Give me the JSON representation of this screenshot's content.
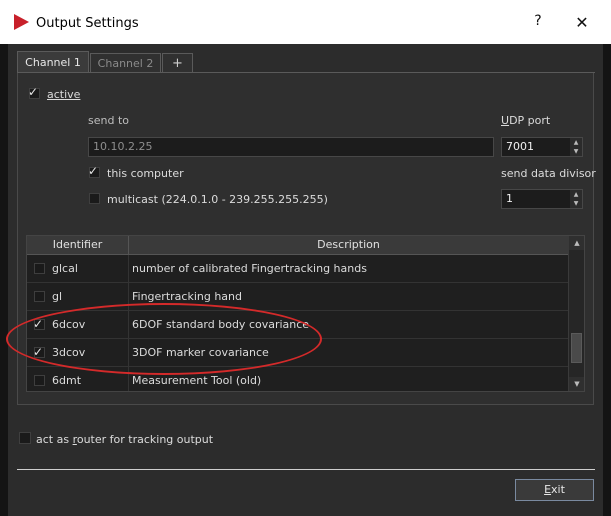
{
  "window": {
    "title": "Output Settings",
    "help_label": "?",
    "close_label": "✕"
  },
  "tabs": [
    {
      "label": "Channel 1"
    },
    {
      "label": "Channel 2"
    },
    {
      "label": "+"
    }
  ],
  "channel": {
    "active_label": "active",
    "send_to_label": "send to",
    "ip_value": "10.10.2.25",
    "udp_port_label": "UDP port",
    "udp_port_value": "7001",
    "this_computer_label": "this computer",
    "send_data_divisor_label": "send data divisor",
    "send_data_divisor_value": "1",
    "multicast_label": "multicast (224.0.1.0 - 239.255.255.255)"
  },
  "table": {
    "headers": {
      "identifier": "Identifier",
      "description": "Description"
    },
    "rows": [
      {
        "id": "glcal",
        "description": "number of calibrated Fingertracking hands",
        "checked": false
      },
      {
        "id": "gl",
        "description": "Fingertracking hand",
        "checked": false
      },
      {
        "id": "6dcov",
        "description": "6DOF standard body covariance",
        "checked": true
      },
      {
        "id": "3dcov",
        "description": "3DOF marker covariance",
        "checked": true
      },
      {
        "id": "6dmt",
        "description": "Measurement Tool (old)",
        "checked": false
      }
    ]
  },
  "router_label": "act as router for tracking output",
  "exit_label": "Exit",
  "colors": {
    "annotation": "#d42a2a",
    "title_logo": "#c8202a",
    "background": "#2c2c2c"
  }
}
